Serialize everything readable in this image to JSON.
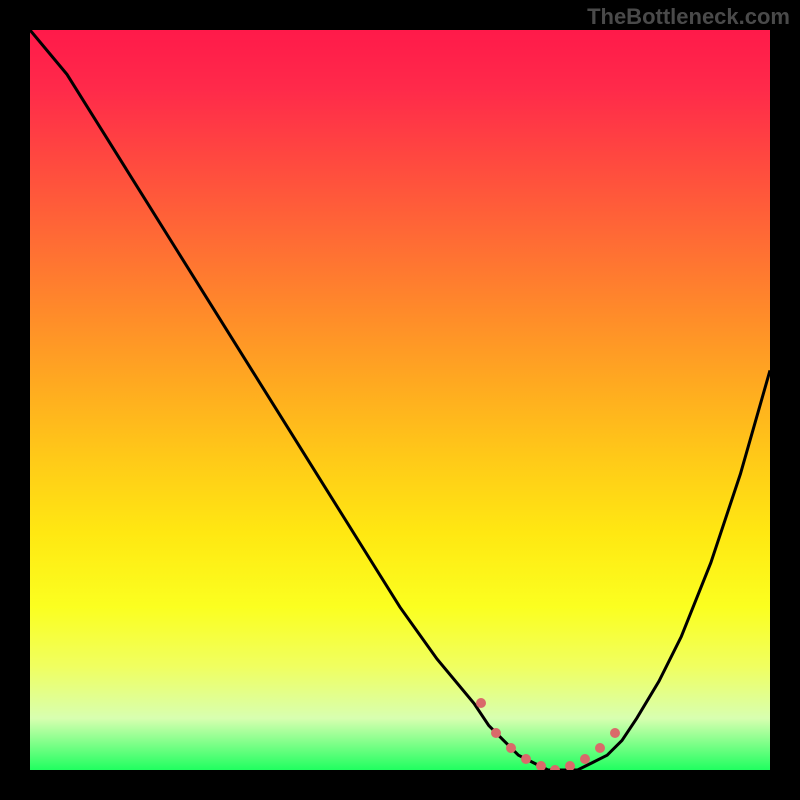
{
  "watermark": "TheBottleneck.com",
  "chart_data": {
    "type": "line",
    "title": "",
    "xlabel": "",
    "ylabel": "",
    "x_range": [
      0,
      100
    ],
    "y_range": [
      0,
      100
    ],
    "series": [
      {
        "name": "curve",
        "x": [
          0,
          5,
          10,
          15,
          20,
          25,
          30,
          35,
          40,
          45,
          50,
          55,
          60,
          62,
          64,
          66,
          68,
          70,
          72,
          74,
          76,
          78,
          80,
          82,
          85,
          88,
          92,
          96,
          100
        ],
        "y": [
          100,
          94,
          86,
          78,
          70,
          62,
          54,
          46,
          38,
          30,
          22,
          15,
          9,
          6,
          4,
          2,
          1,
          0,
          0,
          0,
          1,
          2,
          4,
          7,
          12,
          18,
          28,
          40,
          54
        ]
      }
    ],
    "optimal_points": {
      "name": "optimal-range-dots",
      "color": "#d96a6a",
      "x": [
        61,
        63,
        65,
        67,
        69,
        71,
        73,
        75,
        77,
        79
      ],
      "y": [
        9,
        5,
        3,
        1.5,
        0.5,
        0,
        0.5,
        1.5,
        3,
        5
      ]
    },
    "background": "vertical heat gradient (red top → green bottom)"
  }
}
